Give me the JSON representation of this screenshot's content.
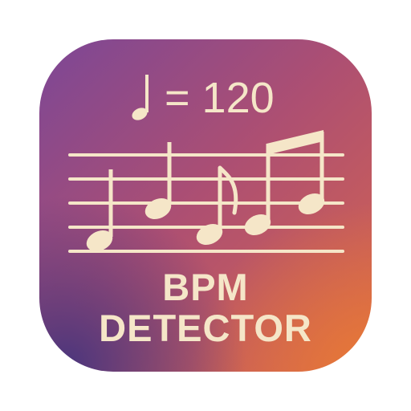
{
  "icon": {
    "tempo_equals": "= 120",
    "title_line_1": "BPM",
    "title_line_2": "DETECTOR",
    "tempo_note_icon": "quarter-note-icon",
    "colors": {
      "foreground": "#f5e6c8",
      "gradient_top_left": "#7c4796",
      "gradient_bottom_left": "#46347d",
      "gradient_bottom_right": "#e87a34"
    }
  }
}
